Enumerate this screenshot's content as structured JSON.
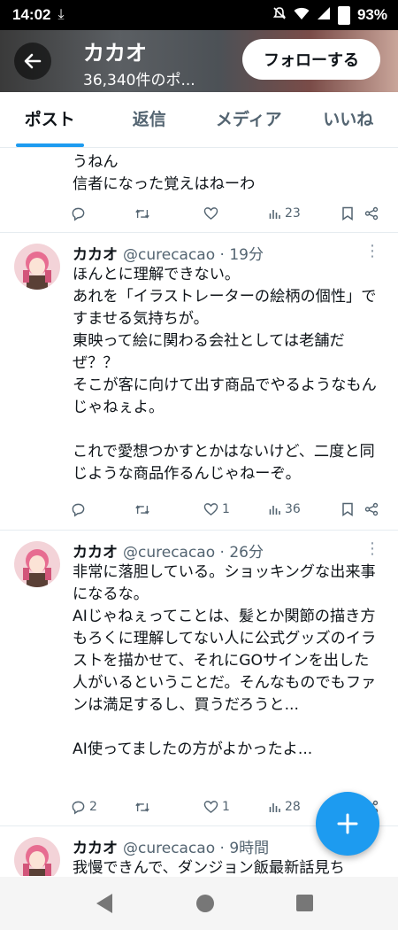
{
  "status_bar": {
    "time": "14:02",
    "battery": "93%"
  },
  "header": {
    "back_label": "←",
    "title": "カカオ",
    "subtitle": "36,340件のポ...",
    "follow_label": "フォローする"
  },
  "tabs": [
    {
      "label": "ポスト",
      "active": true
    },
    {
      "label": "返信",
      "active": false
    },
    {
      "label": "メディア",
      "active": false
    },
    {
      "label": "いいね",
      "active": false
    }
  ],
  "posts": [
    {
      "text": "うねん\n信者になった覚えはねーわ",
      "replies": "",
      "reposts": "",
      "likes": "",
      "views": "23"
    },
    {
      "name": "カカオ",
      "handle": "@curecacao · 19分",
      "text": "ほんとに理解できない。\nあれを「イラストレーターの絵柄の個性」ですませる気持ちが。\n東映って絵に関わる会社としては老舗だぜ？？\nそこが客に向けて出す商品でやるようなもんじゃねぇよ。\n\nこれで愛想つかすとかはないけど、二度と同じような商品作るんじゃねーぞ。",
      "replies": "",
      "reposts": "",
      "likes": "1",
      "views": "36"
    },
    {
      "name": "カカオ",
      "handle": "@curecacao · 26分",
      "text": "非常に落胆している。ショッキングな出来事になるな。\nAIじゃねぇってことは、髪とか関節の描き方もろくに理解してない人に公式グッズのイラストを描かせて、それにGOサインを出した人がいるということだ。そんなものでもファンは満足するし、買うだろうと...\n\nAI使ってましたの方がよかったよ...",
      "replies": "2",
      "reposts": "",
      "likes": "1",
      "views": "28"
    },
    {
      "name": "カカオ",
      "handle": "@curecacao · 9時間",
      "text": "我慢できんで、ダンジョン飯最新話見ち"
    }
  ]
}
